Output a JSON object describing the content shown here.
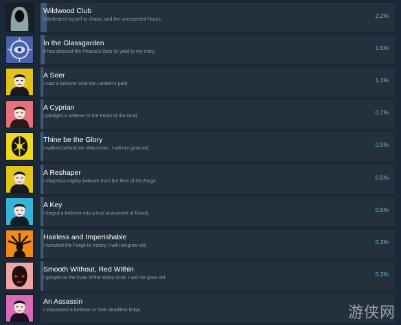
{
  "achievements": [
    {
      "title": "Wildwood Club",
      "description": "I dedicated myself to chaos, and the unexpected Hours.",
      "percent": "2.2%",
      "progress": 0.022,
      "icon": "hooded-figure-icon",
      "icon_bg": "#1a1f24",
      "icon_fg": "#8fa4a8"
    },
    {
      "title": "In the Glassgarden",
      "description": "It has pleased the Peacock Door to yield to my entry.",
      "percent": "1.5%",
      "progress": 0.015,
      "icon": "peacock-eye-icon",
      "icon_bg": "#4a62a8",
      "icon_fg": "#d8e2f4"
    },
    {
      "title": "A Seer",
      "description": "I cast a believer onto the Lantern's path.",
      "percent": "1.1%",
      "progress": 0.011,
      "icon": "seer-portrait-icon",
      "icon_bg": "#e0c21c",
      "icon_fg": "#1a1a1a"
    },
    {
      "title": "A Cyprian",
      "description": "I pledged a believer to the Feast of the Grail.",
      "percent": "0.7%",
      "progress": 0.007,
      "icon": "cyprian-portrait-icon",
      "icon_bg": "#e8707a",
      "icon_fg": "#2a1a1a"
    },
    {
      "title": "Thine be the Glory",
      "description": "I walked behind the Watchman. I will not grow old.",
      "percent": "0.5%",
      "progress": 0.005,
      "icon": "watchman-emblem-icon",
      "icon_bg": "#f0d81e",
      "icon_fg": "#111111"
    },
    {
      "title": "A Reshaper",
      "description": "I shaped a mighty believer from the fires of the Forge.",
      "percent": "0.5%",
      "progress": 0.005,
      "icon": "reshaper-portrait-icon",
      "icon_bg": "#e2c61a",
      "icon_fg": "#1a1a1a"
    },
    {
      "title": "A Key",
      "description": "I forged a believer into a true instrument of Knock.",
      "percent": "0.5%",
      "progress": 0.005,
      "icon": "key-portrait-icon",
      "icon_bg": "#36b4d8",
      "icon_fg": "#0e1e26"
    },
    {
      "title": "Hairless and Imperishable",
      "description": "I wrestled the Forge to victory. I will not grow old.",
      "percent": "0.3%",
      "progress": 0.003,
      "icon": "forge-sun-icon",
      "icon_bg": "#f08a1c",
      "icon_fg": "#1a0e06"
    },
    {
      "title": "Smooth Without, Red Within",
      "description": "I gorged on the fruits of the sticky Grail. I will not grow old.",
      "percent": "0.3%",
      "progress": 0.003,
      "icon": "grail-mask-icon",
      "icon_bg": "#f0a4a4",
      "icon_fg": "#1a1010"
    },
    {
      "title": "An Assassin",
      "description": "I sharpened a believer to their deadliest Edge.",
      "percent": "",
      "progress": 0,
      "icon": "assassin-portrait-icon",
      "icon_bg": "#d86ab8",
      "icon_fg": "#1e1020"
    }
  ],
  "watermark": "游侠网"
}
